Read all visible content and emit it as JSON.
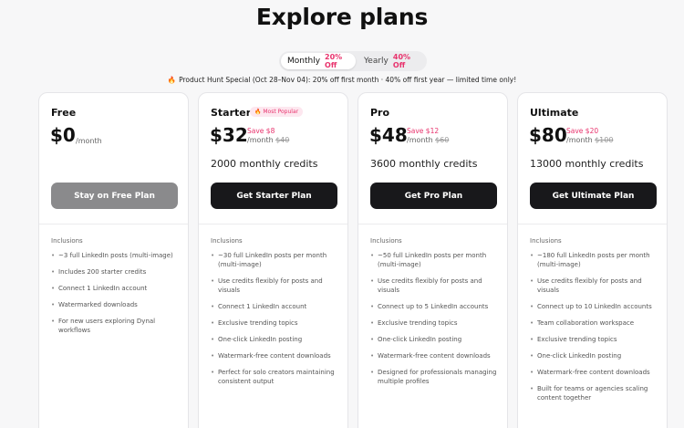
{
  "page": {
    "title": "Explore plans"
  },
  "billing_toggle": {
    "monthly_label": "Monthly",
    "monthly_discount": "20% Off",
    "yearly_label": "Yearly",
    "yearly_discount": "40% Off",
    "selected": "Monthly"
  },
  "promo": {
    "icon": "fire-icon",
    "text": "Product Hunt Special (Oct 28–Nov 04): 20% off first month · 40% off first year — limited time only!"
  },
  "colors": {
    "accent": "#e8336d",
    "button": "#18181b",
    "disabled_button": "#8a8a8c"
  },
  "plans": [
    {
      "name": "Free",
      "price": "$0",
      "per": "/month",
      "cta": "Stay on Free Plan",
      "inclusions_label": "Inclusions",
      "features": [
        "~3 full LinkedIn posts (multi-image)",
        "Includes 200 starter credits",
        "Connect 1 LinkedIn account",
        "Watermarked downloads",
        "For new users exploring Dynal workflows"
      ]
    },
    {
      "name": "Starter",
      "badge": "🔥 Most Popular",
      "price": "$32",
      "save": "Save $8",
      "per": "/month",
      "original": "$40",
      "credits": "2000 monthly credits",
      "cta": "Get Starter Plan",
      "inclusions_label": "Inclusions",
      "features": [
        "~30 full LinkedIn posts per month (multi-image)",
        "Use credits flexibly for posts and visuals",
        "Connect 1 LinkedIn account",
        "Exclusive trending topics",
        "One-click LinkedIn posting",
        "Watermark-free content downloads",
        "Perfect for solo creators maintaining consistent output"
      ]
    },
    {
      "name": "Pro",
      "price": "$48",
      "save": "Save $12",
      "per": "/month",
      "original": "$60",
      "credits": "3600 monthly credits",
      "cta": "Get Pro Plan",
      "inclusions_label": "Inclusions",
      "features": [
        "~50 full LinkedIn posts per month (multi-image)",
        "Use credits flexibly for posts and visuals",
        "Connect up to 5 LinkedIn accounts",
        "Exclusive trending topics",
        "One-click LinkedIn posting",
        "Watermark-free content downloads",
        "Designed for professionals managing multiple profiles"
      ]
    },
    {
      "name": "Ultimate",
      "price": "$80",
      "save": "Save $20",
      "per": "/month",
      "original": "$100",
      "credits": "13000 monthly credits",
      "cta": "Get Ultimate Plan",
      "inclusions_label": "Inclusions",
      "features": [
        "~180 full LinkedIn posts per month (multi-image)",
        "Use credits flexibly for posts and visuals",
        "Connect up to 10 LinkedIn accounts",
        "Team collaboration workspace",
        "Exclusive trending topics",
        "One-click LinkedIn posting",
        "Watermark-free content downloads",
        "Built for teams or agencies scaling content together"
      ]
    }
  ]
}
